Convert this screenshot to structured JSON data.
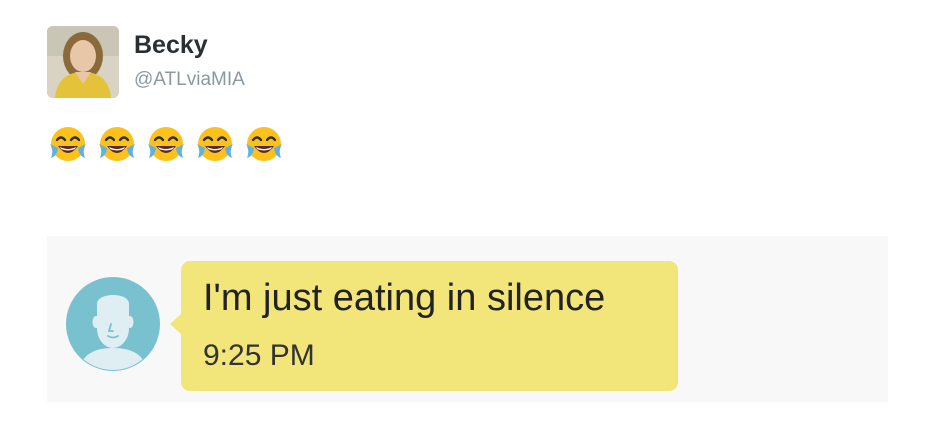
{
  "tweet": {
    "display_name": "Becky",
    "handle": "@ATLviaMIA",
    "emoji_icons": [
      "face-with-tears-of-joy-icon",
      "face-with-tears-of-joy-icon",
      "face-with-tears-of-joy-icon",
      "face-with-tears-of-joy-icon",
      "face-with-tears-of-joy-icon"
    ]
  },
  "chat": {
    "message": "I'm just eating in silence",
    "time": "9:25 PM",
    "bubble_color": "#f2e57a",
    "contact_avatar_color": "#79c1cf"
  },
  "colors": {
    "name": "#292f33",
    "handle": "#8899a6",
    "panel_bg": "#f8f8f8"
  }
}
